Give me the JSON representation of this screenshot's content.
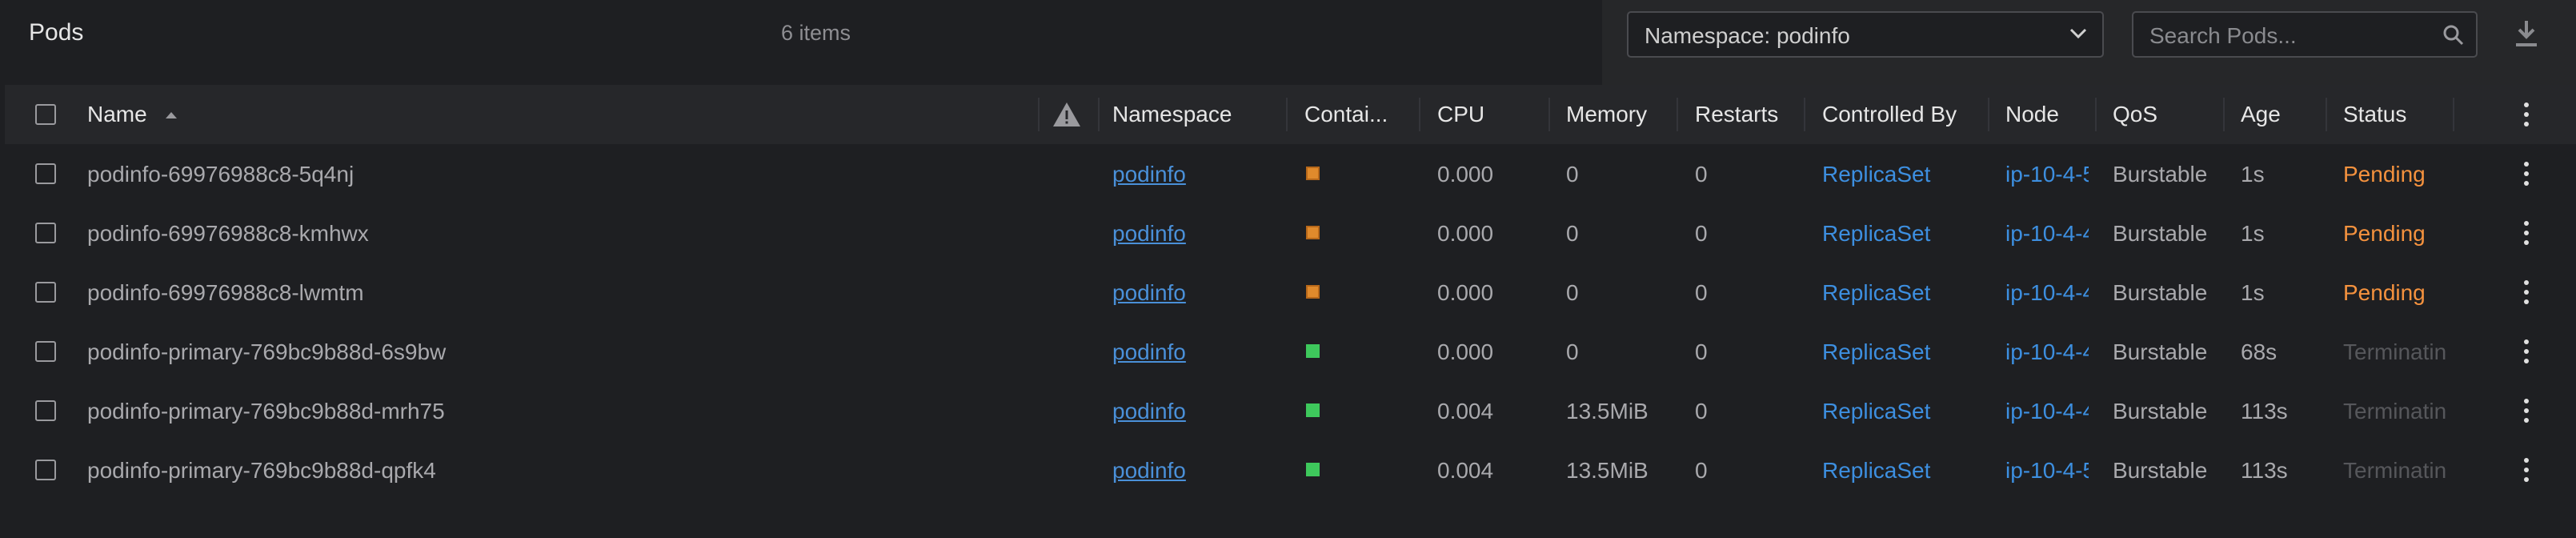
{
  "header": {
    "title": "Pods",
    "count": "6 items"
  },
  "filters": {
    "namespace_label": "Namespace: podinfo",
    "search_placeholder": "Search Pods..."
  },
  "columns": {
    "name": "Name",
    "namespace": "Namespace",
    "containers": "Contai...",
    "cpu": "CPU",
    "memory": "Memory",
    "restarts": "Restarts",
    "controlled_by": "Controlled By",
    "node": "Node",
    "qos": "QoS",
    "age": "Age",
    "status": "Status"
  },
  "colors": {
    "pending": "#f5923e",
    "running": "#3ec85c",
    "container_pending": "#e08a2c",
    "link": "#3d8fe0"
  },
  "rows": [
    {
      "name": "podinfo-69976988c8-5q4nj",
      "namespace": "podinfo",
      "container_state": "pending",
      "cpu": "0.000",
      "memory": "0",
      "restarts": "0",
      "controlled_by": "ReplicaSet",
      "node": "ip-10-4-5",
      "qos": "Burstable",
      "age": "1s",
      "status": "Pending"
    },
    {
      "name": "podinfo-69976988c8-kmhwx",
      "namespace": "podinfo",
      "container_state": "pending",
      "cpu": "0.000",
      "memory": "0",
      "restarts": "0",
      "controlled_by": "ReplicaSet",
      "node": "ip-10-4-4",
      "qos": "Burstable",
      "age": "1s",
      "status": "Pending"
    },
    {
      "name": "podinfo-69976988c8-lwmtm",
      "namespace": "podinfo",
      "container_state": "pending",
      "cpu": "0.000",
      "memory": "0",
      "restarts": "0",
      "controlled_by": "ReplicaSet",
      "node": "ip-10-4-4",
      "qos": "Burstable",
      "age": "1s",
      "status": "Pending"
    },
    {
      "name": "podinfo-primary-769bc9b88d-6s9bw",
      "namespace": "podinfo",
      "container_state": "running",
      "cpu": "0.000",
      "memory": "0",
      "restarts": "0",
      "controlled_by": "ReplicaSet",
      "node": "ip-10-4-4",
      "qos": "Burstable",
      "age": "68s",
      "status": "Terminatin"
    },
    {
      "name": "podinfo-primary-769bc9b88d-mrh75",
      "namespace": "podinfo",
      "container_state": "running",
      "cpu": "0.004",
      "memory": "13.5MiB",
      "restarts": "0",
      "controlled_by": "ReplicaSet",
      "node": "ip-10-4-4",
      "qos": "Burstable",
      "age": "113s",
      "status": "Terminatin"
    },
    {
      "name": "podinfo-primary-769bc9b88d-qpfk4",
      "namespace": "podinfo",
      "container_state": "running",
      "cpu": "0.004",
      "memory": "13.5MiB",
      "restarts": "0",
      "controlled_by": "ReplicaSet",
      "node": "ip-10-4-5",
      "qos": "Burstable",
      "age": "113s",
      "status": "Terminatin"
    }
  ]
}
